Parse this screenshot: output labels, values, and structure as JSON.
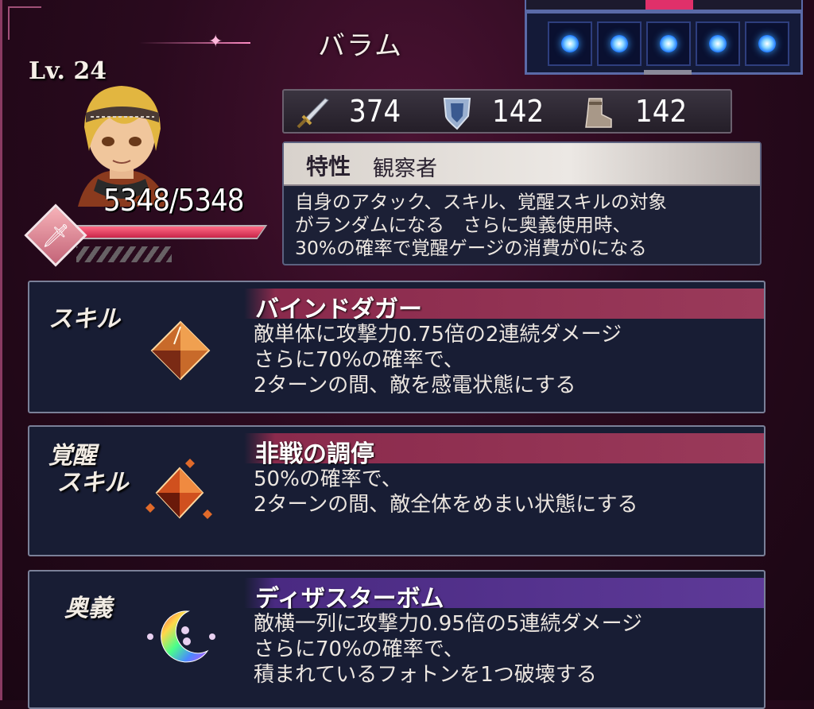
{
  "character": {
    "name": "バラム",
    "level": "Lv. 24",
    "hp": "5348/5348",
    "hp_fraction": 1.0
  },
  "slots": {
    "count": 5,
    "icon": "blue-orb-icon"
  },
  "stats": [
    {
      "icon": "sword-icon",
      "value": "374"
    },
    {
      "icon": "shield-icon",
      "value": "142"
    },
    {
      "icon": "boot-icon",
      "value": "142"
    }
  ],
  "trait": {
    "label": "特性",
    "name": "観察者",
    "text": "自身のアタック、スキル、覚醒スキルの対象\nがランダムになる　さらに奥義使用時、\n30%の確率で覚醒ゲージの消費が0になる"
  },
  "skill": {
    "label": "スキル",
    "name": "バインドダガー",
    "desc": "敵単体に攻撃力0.75倍の2連続ダメージ\nさらに70%の確率で、\n2ターンの間、敵を感電状態にする"
  },
  "awaken": {
    "label": "覚醒\n スキル",
    "name": "非戦の調停",
    "desc": "50%の確率で、\n2ターンの間、敵全体をめまい状態にする"
  },
  "ultimate": {
    "label": "奥義",
    "name": "ディザスターボム",
    "desc": "敵横一列に攻撃力0.95倍の5連続ダメージ\nさらに70%の確率で、\n積まれているフォトンを1つ破壊する"
  },
  "colors": {
    "skill_header": "#9a3a5a",
    "ultimate_header": "#5e3a98",
    "hp_bar": "#e03a5a",
    "slot_orb": "#3aa0ff"
  }
}
